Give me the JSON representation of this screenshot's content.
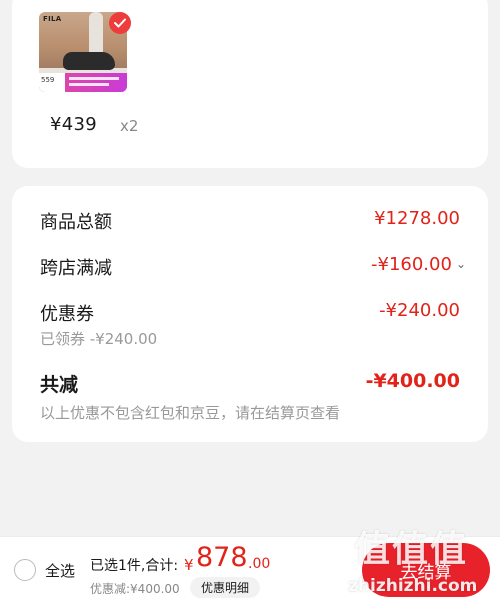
{
  "product": {
    "brand": "FILA",
    "thumb_price": "559",
    "price": "¥439",
    "quantity": "x2"
  },
  "summary": {
    "total_label": "商品总额",
    "total_value": "¥1278.00",
    "store_discount_label": "跨店满减",
    "store_discount_value": "-¥160.00",
    "coupon_label": "优惠券",
    "coupon_value": "-¥240.00",
    "coupon_sub": "已领券 -¥240.00",
    "sum_label": "共减",
    "sum_value": "-¥400.00",
    "note": "以上优惠不包含红包和京豆，请在结算页查看"
  },
  "bottom": {
    "select_all": "全选",
    "selected": "已选1件,合计:",
    "currency": "¥",
    "total_int": "878",
    "total_dec": ".00",
    "discount": "优惠减:¥400.00",
    "detail_button": "优惠明细",
    "checkout": "去结算"
  },
  "watermark": {
    "top": "值值值",
    "bottom": "zhizhizhi.com"
  },
  "colors": {
    "accent_red": "#e2231a",
    "button_red": "#e8222b",
    "background": "#f2f2f2"
  }
}
